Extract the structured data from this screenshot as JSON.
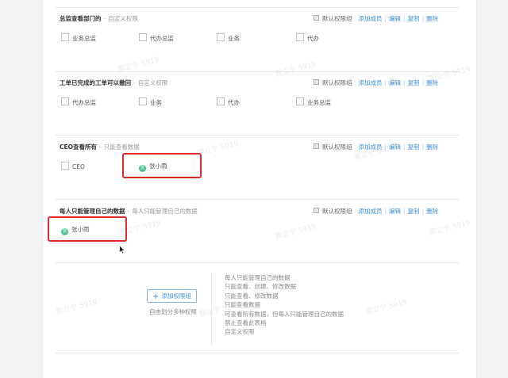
{
  "action_labels": {
    "default_group": "默认权限组",
    "add_member": "添加成员",
    "edit": "编辑",
    "copy": "复制",
    "delete": "删除"
  },
  "groups": [
    {
      "name": "总监查看部门的",
      "desc": "自定义权限",
      "members": [
        {
          "type": "dept",
          "name": "业务总监"
        },
        {
          "type": "dept",
          "name": "代办总监"
        },
        {
          "type": "dept",
          "name": "业务"
        },
        {
          "type": "dept",
          "name": "代办"
        }
      ]
    },
    {
      "name": "工单已完成的工单可以撤回",
      "desc": "自定义权限",
      "members": [
        {
          "type": "dept",
          "name": "代办总监"
        },
        {
          "type": "dept",
          "name": "业务"
        },
        {
          "type": "dept",
          "name": "代办"
        },
        {
          "type": "dept",
          "name": "业务总监"
        }
      ]
    },
    {
      "name": "CEO查看所有",
      "desc": "只能查看数据",
      "members": [
        {
          "type": "dept",
          "name": "CEO"
        },
        {
          "type": "user",
          "name": "张小雨",
          "avatar": "张"
        }
      ]
    },
    {
      "name": "每人只能管理自己的数据",
      "desc": "每人只能管理自己的数据",
      "members": [
        {
          "type": "user",
          "name": "张小雨",
          "avatar": "张"
        }
      ]
    }
  ],
  "add_group": {
    "button_label": "添加权限组",
    "hint": "自由划分多种权限"
  },
  "preset_hints": [
    "每人只能管理自己的数据",
    "只能查看、创建、修改数据",
    "只能查看、修改数据",
    "只能查看数据",
    "可查看所有数据，但每人只能管理自己的数据",
    "禁止查看此表格",
    "自定义权限"
  ],
  "watermark_text": "郭立宁 5919",
  "colors": {
    "link": "#3b8fd9",
    "highlight_box": "#e12b2b",
    "avatar": "#4fc08d"
  },
  "icons": {
    "dept": "dept-icon",
    "user": "user-avatar-icon",
    "add": "plus-icon",
    "cursor": "mouse-pointer-icon"
  }
}
